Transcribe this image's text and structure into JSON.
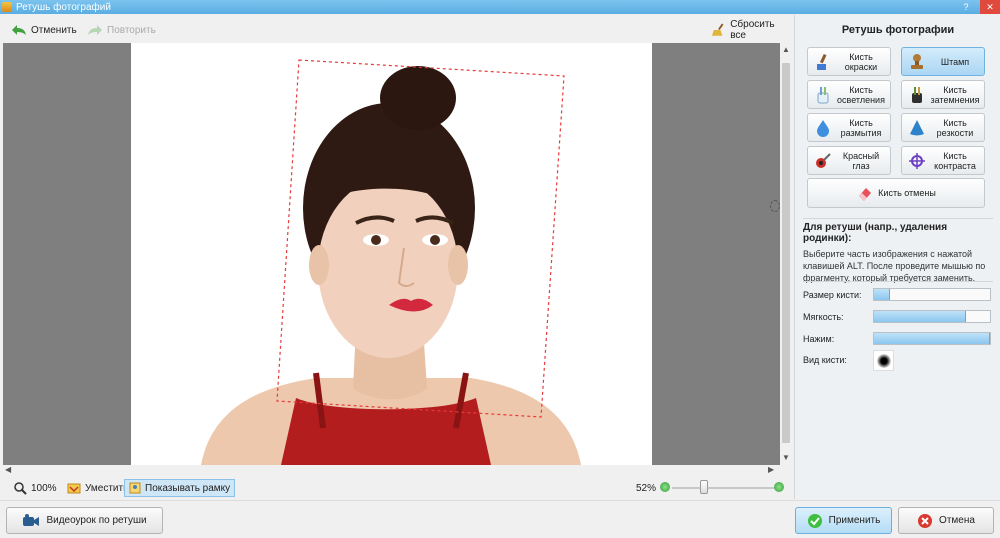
{
  "window": {
    "title": "Ретушь фотографий"
  },
  "toolbar": {
    "undo_label": "Отменить",
    "redo_label": "Повторить",
    "reset_label": "Сбросить все"
  },
  "statusbar": {
    "zoom_100_label": "100%",
    "fit_label": "Уместить",
    "show_frame_label": "Показывать рамку",
    "zoom_percent": "52%",
    "zoom_level": 0.52
  },
  "panel": {
    "title": "Ретушь фотографии",
    "tools": [
      {
        "label": "Кисть окраски",
        "icon": "paint-brush-icon",
        "selected": false
      },
      {
        "label": "Штамп",
        "icon": "stamp-icon",
        "selected": true
      },
      {
        "label": "Кисть осветления",
        "icon": "lighten-brush-icon",
        "selected": false
      },
      {
        "label": "Кисть затемнения",
        "icon": "darken-brush-icon",
        "selected": false
      },
      {
        "label": "Кисть размытия",
        "icon": "blur-drop-icon",
        "selected": false
      },
      {
        "label": "Кисть резкости",
        "icon": "sharpen-cone-icon",
        "selected": false
      },
      {
        "label": "Красный глаз",
        "icon": "red-eye-icon",
        "selected": false
      },
      {
        "label": "Кисть контраста",
        "icon": "contrast-icon",
        "selected": false
      },
      {
        "label": "Кисть отмены",
        "icon": "eraser-icon",
        "selected": false
      }
    ],
    "hint_title": "Для ретуши (напр., удаления родинки):",
    "hint_text": "Выберите часть изображения с нажатой клавишей ALT. После проведите мышью по фрагменту, который требуется заменить.",
    "sliders": [
      {
        "label": "Размер кисти:",
        "value": 0.14
      },
      {
        "label": "Мягкость:",
        "value": 0.79
      },
      {
        "label": "Нажим:",
        "value": 1.0
      }
    ],
    "brush_view_label": "Вид кисти:"
  },
  "bottom": {
    "tutorial_label": "Видеоурок по ретуши",
    "apply_label": "Применить",
    "cancel_label": "Отмена"
  },
  "colors": {
    "accent": "#5aaee3",
    "selection": "#aad6f4",
    "apply_icon": "#3fbf3f",
    "cancel_icon": "#d83a2f"
  }
}
